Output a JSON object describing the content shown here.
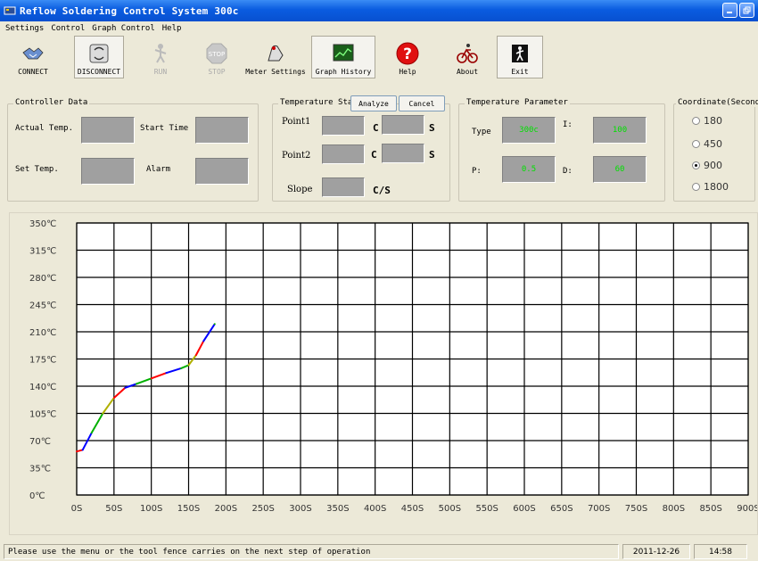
{
  "window": {
    "title": "Reflow Soldering Control System 300c"
  },
  "menu": [
    "Settings",
    "Control",
    "Graph Control",
    "Help"
  ],
  "toolbar": [
    {
      "label": "CONNECT",
      "icon": "handshake-icon",
      "state": "normal"
    },
    {
      "label": "DISCONNECT",
      "icon": "disconnect-icon",
      "state": "pressed"
    },
    {
      "label": "RUN",
      "icon": "run-icon",
      "state": "disabled"
    },
    {
      "label": "STOP",
      "icon": "stop-icon",
      "state": "disabled"
    },
    {
      "label": "Meter Settings",
      "icon": "meter-icon",
      "state": "normal"
    },
    {
      "label": "Graph History",
      "icon": "graph-icon",
      "state": "normal"
    },
    {
      "label": "Help",
      "icon": "help-icon",
      "state": "normal"
    },
    {
      "label": "About",
      "icon": "bicycle-icon",
      "state": "normal"
    },
    {
      "label": "Exit",
      "icon": "exit-icon",
      "state": "normal"
    }
  ],
  "controller": {
    "legend": "Controller Data",
    "actual_temp_label": "Actual Temp.",
    "start_time_label": "Start Time",
    "set_temp_label": "Set Temp.",
    "alarm_label": "Alarm"
  },
  "temp_stat": {
    "legend": "Temperature Stat",
    "analyze": "Analyze",
    "cancel": "Cancel",
    "point1": "Point1",
    "point2": "Point2",
    "slope": "Slope",
    "unit_c": "C",
    "unit_s": "S",
    "unit_slope": "C/S"
  },
  "temp_param": {
    "legend": "Temperature Parameter",
    "type_label": "Type",
    "type_value": "300c",
    "i_label": "I:",
    "i_value": "100",
    "p_label": "P:",
    "p_value": "0.5",
    "d_label": "D:",
    "d_value": "60"
  },
  "coordinate": {
    "legend": "Coordinate(Second)",
    "options": [
      "180",
      "450",
      "900",
      "1800"
    ],
    "selected": "900"
  },
  "chart_data": {
    "type": "line",
    "x_ticks": [
      "0S",
      "50S",
      "100S",
      "150S",
      "200S",
      "250S",
      "300S",
      "350S",
      "400S",
      "450S",
      "500S",
      "550S",
      "600S",
      "650S",
      "700S",
      "750S",
      "800S",
      "850S",
      "900S"
    ],
    "y_ticks": [
      "0℃",
      "35℃",
      "70℃",
      "105℃",
      "140℃",
      "175℃",
      "210℃",
      "245℃",
      "280℃",
      "315℃",
      "350℃"
    ],
    "xlim": [
      0,
      900
    ],
    "ylim": [
      0,
      350
    ],
    "grid": true,
    "series": [
      {
        "x": [
          0,
          8,
          20,
          35,
          50,
          65,
          80,
          100,
          120,
          140,
          150,
          160,
          170,
          185
        ],
        "y": [
          56,
          58,
          80,
          105,
          125,
          138,
          143,
          150,
          157,
          163,
          167,
          180,
          198,
          220
        ]
      }
    ],
    "segment_colors": [
      "#ff0000",
      "#0000ff",
      "#00b000",
      "#b0b000",
      "#ff0000",
      "#0000ff",
      "#00b000"
    ]
  },
  "status": {
    "message": "Please use the menu or the tool fence carries on the next step of operation",
    "date": "2011-12-26",
    "time": "14:58"
  }
}
